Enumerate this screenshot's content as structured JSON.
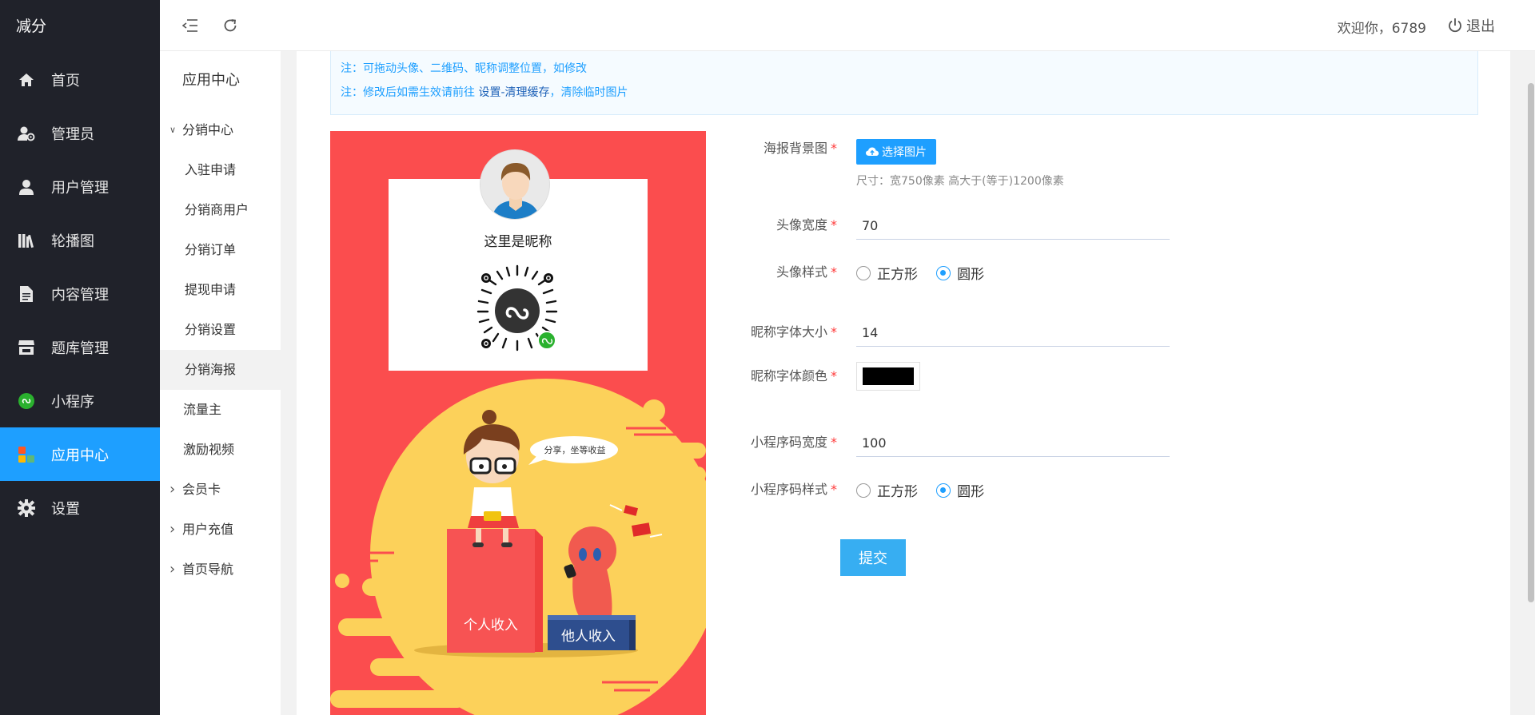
{
  "brand": "减分",
  "nav": [
    {
      "label": "首页",
      "icon": "home-icon"
    },
    {
      "label": "管理员",
      "icon": "admin-user-icon"
    },
    {
      "label": "用户管理",
      "icon": "user-icon"
    },
    {
      "label": "轮播图",
      "icon": "books-icon"
    },
    {
      "label": "内容管理",
      "icon": "document-icon"
    },
    {
      "label": "题库管理",
      "icon": "store-icon"
    },
    {
      "label": "小程序",
      "icon": "mini-program-icon"
    },
    {
      "label": "应用中心",
      "icon": "app-grid-icon"
    },
    {
      "label": "设置",
      "icon": "gear-icon"
    }
  ],
  "header": {
    "welcome": "欢迎你，6789",
    "logout": "退出"
  },
  "subnav": {
    "title": "应用中心",
    "items": [
      {
        "label": "分销中心",
        "type": "group",
        "arrow": "expanded"
      },
      {
        "label": "入驻申请",
        "type": "child"
      },
      {
        "label": "分销商用户",
        "type": "child"
      },
      {
        "label": "分销订单",
        "type": "child"
      },
      {
        "label": "提现申请",
        "type": "child"
      },
      {
        "label": "分销设置",
        "type": "child"
      },
      {
        "label": "分销海报",
        "type": "child",
        "selected": true
      },
      {
        "label": "流量主",
        "type": "plain"
      },
      {
        "label": "激励视频",
        "type": "plain"
      },
      {
        "label": "会员卡",
        "type": "group",
        "arrow": "collapsed"
      },
      {
        "label": "用户充值",
        "type": "group",
        "arrow": "collapsed"
      },
      {
        "label": "首页导航",
        "type": "group",
        "arrow": "collapsed"
      }
    ]
  },
  "notice": {
    "line1": "注：可拖动头像、二维码、昵称调整位置，如修改",
    "line2_prefix": "注：修改后如需生效请前往 ",
    "line2_link": "设置-清理缓存",
    "line2_suffix": "，清除临时图片"
  },
  "poster": {
    "nickname": "这里是昵称",
    "speech": "分享，坐等收益",
    "box_left": "个人收入",
    "box_right": "他人收入"
  },
  "form": {
    "bg_label": "海报背景图",
    "bg_button": "选择图片",
    "bg_hint": "尺寸：宽750像素 高大于(等于)1200像素",
    "avatar_width_label": "头像宽度",
    "avatar_width_value": "70",
    "avatar_style_label": "头像样式",
    "avatar_style_options": [
      "正方形",
      "圆形"
    ],
    "avatar_style_selected": "圆形",
    "nick_size_label": "昵称字体大小",
    "nick_size_value": "14",
    "nick_color_label": "昵称字体颜色",
    "nick_color_value": "#000000",
    "qr_width_label": "小程序码宽度",
    "qr_width_value": "100",
    "qr_style_label": "小程序码样式",
    "qr_style_options": [
      "正方形",
      "圆形"
    ],
    "qr_style_selected": "圆形",
    "submit": "提交"
  },
  "colors": {
    "sidebar_bg": "#20222a",
    "accent": "#1e9fff",
    "poster_bg": "#fb4d4e",
    "poster_yellow": "#fcd15a",
    "submit_bg": "#37aef2"
  }
}
